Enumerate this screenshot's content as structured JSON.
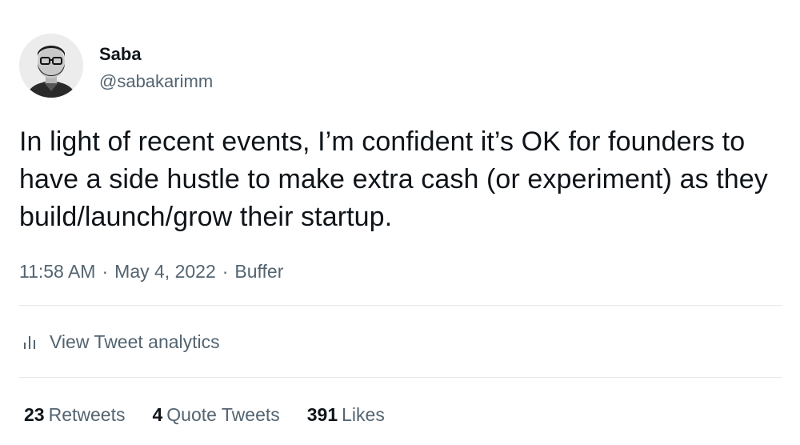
{
  "author": {
    "display_name": "Saba",
    "handle": "@sabakarimm",
    "avatar_icon": "profile-avatar"
  },
  "tweet": {
    "text": "In light of recent events, I’m confident it’s OK for founders to have a side hustle to make extra cash (or experiment) as they build/launch/grow their startup.",
    "time": "11:58 AM",
    "separator": "·",
    "date": "May 4, 2022",
    "source": "Buffer"
  },
  "analytics": {
    "label": "View Tweet analytics",
    "icon": "analytics-icon"
  },
  "stats": [
    {
      "count": "23",
      "label": "Retweets"
    },
    {
      "count": "4",
      "label": "Quote Tweets"
    },
    {
      "count": "391",
      "label": "Likes"
    }
  ],
  "colors": {
    "text_primary": "#0f1419",
    "text_secondary": "#536471",
    "divider": "#e7e9ea"
  }
}
